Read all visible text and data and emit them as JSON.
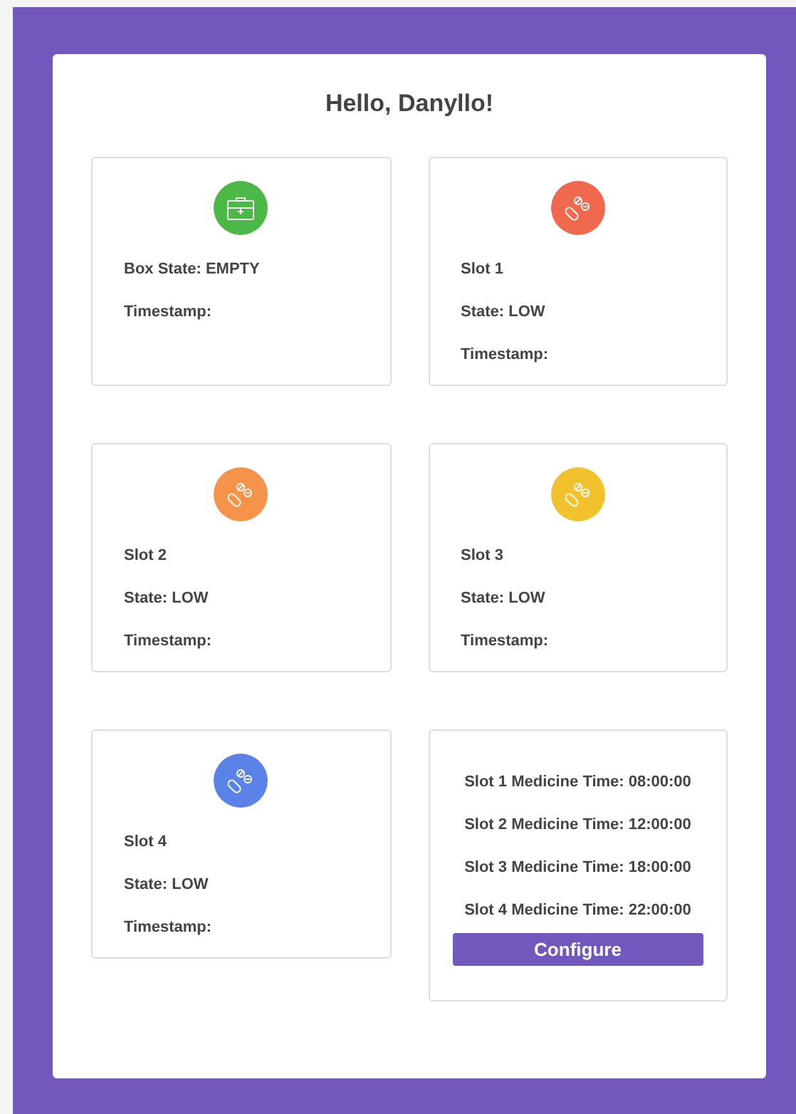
{
  "greeting": "Hello, Danyllo!",
  "rows": [
    [
      {
        "kind": "box",
        "color": "#4cb848",
        "lines": [
          "Box State: EMPTY",
          "Timestamp:"
        ]
      },
      {
        "kind": "slot",
        "color": "#f0694e",
        "lines": [
          "Slot 1",
          "State: LOW",
          "Timestamp:"
        ]
      }
    ],
    [
      {
        "kind": "slot",
        "color": "#f5934a",
        "lines": [
          "Slot 2",
          "State: LOW",
          "Timestamp:"
        ]
      },
      {
        "kind": "slot",
        "color": "#f2c22e",
        "lines": [
          "Slot 3",
          "State: LOW",
          "Timestamp:"
        ]
      }
    ],
    [
      {
        "kind": "slot",
        "color": "#5b82e6",
        "lines": [
          "Slot 4",
          "State: LOW",
          "Timestamp:"
        ]
      },
      {
        "kind": "schedule",
        "lines": [
          "Slot 1 Medicine Time: 08:00:00",
          "Slot 2 Medicine Time: 12:00:00",
          "Slot 3 Medicine Time: 18:00:00",
          "Slot 4 Medicine Time: 22:00:00"
        ],
        "button": "Configure"
      }
    ]
  ]
}
